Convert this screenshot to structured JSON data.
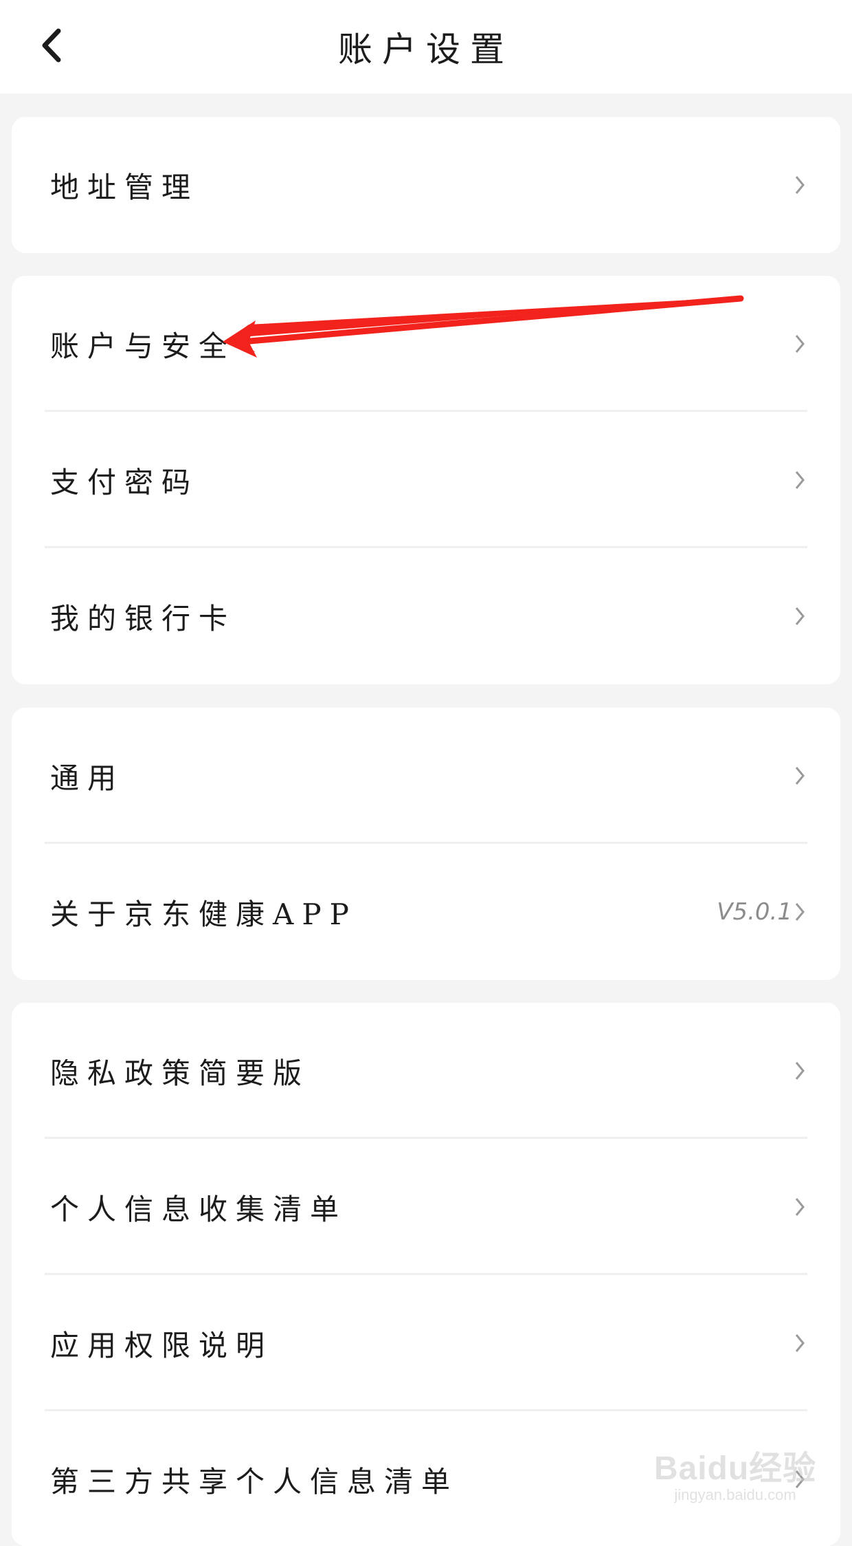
{
  "header": {
    "title": "账户设置",
    "back_icon": "chevron-left-icon"
  },
  "groups": [
    {
      "items": [
        {
          "label": "地址管理",
          "value": ""
        }
      ]
    },
    {
      "items": [
        {
          "label": "账户与安全",
          "value": ""
        },
        {
          "label": "支付密码",
          "value": ""
        },
        {
          "label": "我的银行卡",
          "value": ""
        }
      ]
    },
    {
      "items": [
        {
          "label": "通用",
          "value": ""
        },
        {
          "label": "关于京东健康APP",
          "value": "V5.0.1"
        }
      ]
    },
    {
      "items": [
        {
          "label": "隐私政策简要版",
          "value": ""
        },
        {
          "label": "个人信息收集清单",
          "value": ""
        },
        {
          "label": "应用权限说明",
          "value": ""
        },
        {
          "label": "第三方共享个人信息清单",
          "value": ""
        }
      ]
    }
  ],
  "annotation": {
    "color": "#f2231d",
    "points_to": "账户与安全"
  },
  "watermark": {
    "text": "Baidu经验",
    "sub": "jingyan.baidu.com"
  },
  "colors": {
    "background": "#f4f4f4",
    "card": "#ffffff",
    "chevron": "#9a9a9a"
  }
}
